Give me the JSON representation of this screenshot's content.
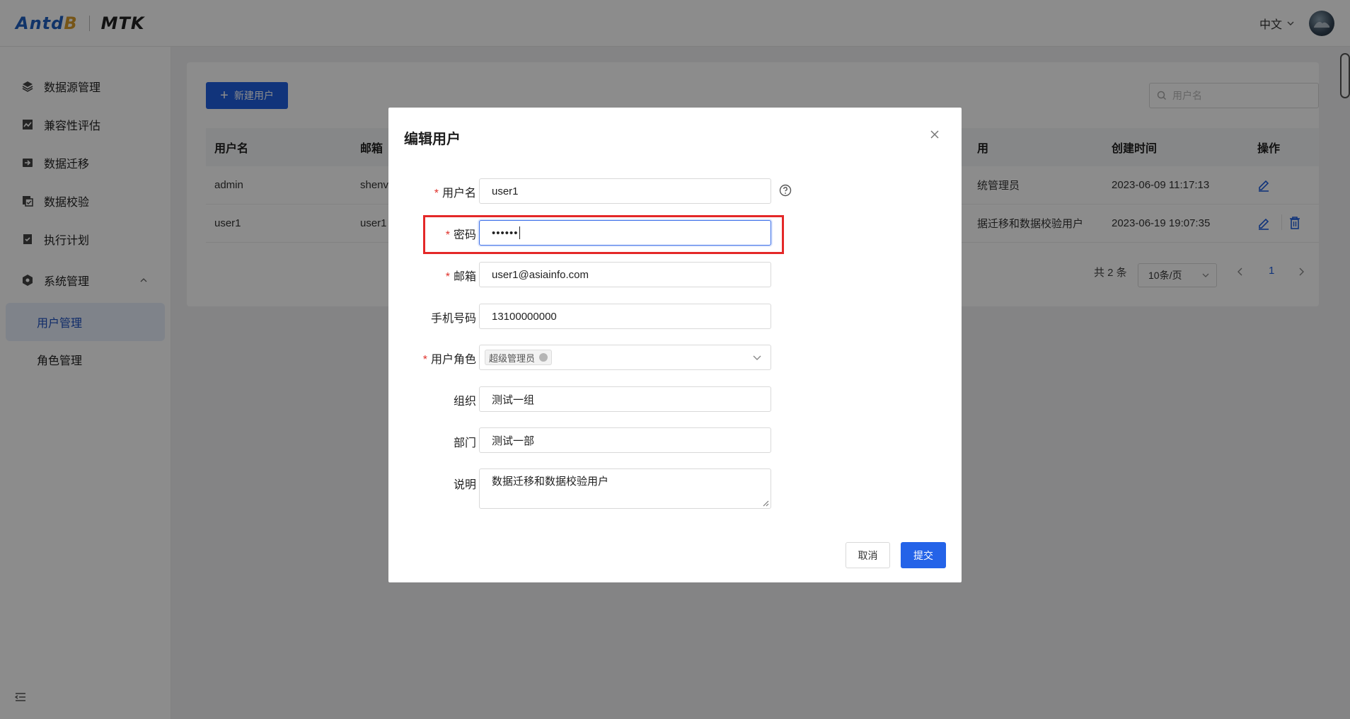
{
  "header": {
    "logo_brand": "Antd",
    "logo_brand_accent": "B",
    "logo_product": "MTK",
    "language": "中文"
  },
  "sidebar": {
    "items": [
      {
        "label": "数据源管理",
        "icon": "layers-icon"
      },
      {
        "label": "兼容性评估",
        "icon": "chart-icon"
      },
      {
        "label": "数据迁移",
        "icon": "migrate-icon"
      },
      {
        "label": "数据校验",
        "icon": "copy-check-icon"
      },
      {
        "label": "执行计划",
        "icon": "checklist-icon"
      },
      {
        "label": "系统管理",
        "icon": "settings-hex-icon"
      }
    ],
    "sub_items": [
      {
        "label": "用户管理"
      },
      {
        "label": "角色管理"
      }
    ]
  },
  "toolbar": {
    "new_user_label": "新建用户",
    "search_placeholder": "用户名"
  },
  "table": {
    "columns": [
      "用户名",
      "邮箱",
      "用",
      "创建时间",
      "操作"
    ],
    "rows": [
      {
        "username": "admin",
        "email": "shenv",
        "desc": "统管理员",
        "created": "2023-06-09 11:17:13"
      },
      {
        "username": "user1",
        "email": "user1",
        "desc": "据迁移和数据校验用户",
        "created": "2023-06-19 19:07:35"
      }
    ]
  },
  "pagination": {
    "total": "共 2 条",
    "page_size": "10条/页",
    "current_page": "1"
  },
  "modal": {
    "title": "编辑用户",
    "fields": {
      "username_label": "用户名",
      "username_value": "user1",
      "password_label": "密码",
      "password_value": "••••••",
      "email_label": "邮箱",
      "email_value": "user1@asiainfo.com",
      "phone_label": "手机号码",
      "phone_value": "13100000000",
      "role_label": "用户角色",
      "role_tag": "超级管理员",
      "org_label": "组织",
      "org_value": "测试一组",
      "dept_label": "部门",
      "dept_value": "测试一部",
      "desc_label": "说明",
      "desc_value": "数据迁移和数据校验用户"
    },
    "cancel_label": "取消",
    "submit_label": "提交"
  },
  "colors": {
    "primary": "#1f5fe0",
    "required": "#e0312b",
    "highlight_border": "#e42828"
  }
}
